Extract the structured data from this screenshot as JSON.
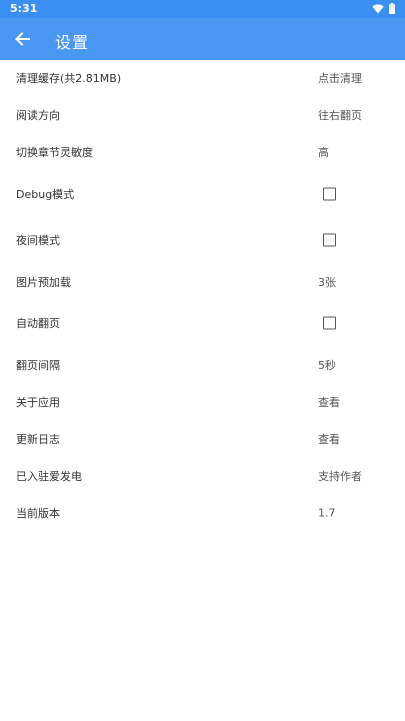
{
  "status_bar": {
    "time": "5:31",
    "icons": [
      "wifi-icon",
      "battery-icon"
    ]
  },
  "app_bar": {
    "title": "设置",
    "back_icon": "arrow-left-icon",
    "color": "#4a97f2"
  },
  "settings": [
    {
      "label": "清理缓存(共2.81MB)",
      "type": "action",
      "value": "点击清理"
    },
    {
      "label": "阅读方向",
      "type": "value",
      "value": "往右翻页"
    },
    {
      "label": "切换章节灵敏度",
      "type": "value",
      "value": "高"
    },
    {
      "label": "Debug模式",
      "type": "checkbox",
      "checked": false
    },
    {
      "label": "夜间模式",
      "type": "checkbox",
      "checked": false
    },
    {
      "label": "图片预加载",
      "type": "value",
      "value": "3张"
    },
    {
      "label": "自动翻页",
      "type": "checkbox",
      "checked": false
    },
    {
      "label": "翻页间隔",
      "type": "value",
      "value": "5秒"
    },
    {
      "label": "关于应用",
      "type": "action",
      "value": "查看"
    },
    {
      "label": "更新日志",
      "type": "action",
      "value": "查看"
    },
    {
      "label": "已入驻爱发电",
      "type": "action",
      "value": "支持作者"
    },
    {
      "label": "当前版本",
      "type": "value",
      "value": "1.7"
    }
  ]
}
